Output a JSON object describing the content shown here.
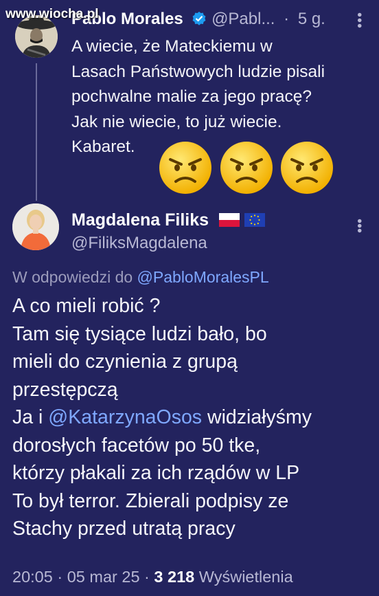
{
  "watermark": "www.wiocha.pl",
  "tweet1": {
    "display_name": "Pablo Morales",
    "handle": "@Pabl...",
    "time": "5 g.",
    "separator": "·",
    "body_lines": [
      "A wiecie, że Mateckiemu w",
      "Lasach Państwowych ludzie pisali",
      "pochwalne malie za jego pracę?",
      "Jak nie wiecie, to już wiecie.",
      "Kabaret."
    ],
    "emojis": [
      "angry-face-icon",
      "angry-face-icon",
      "angry-face-icon"
    ],
    "verified_icon": "verified-badge-icon",
    "more_icon": "more-options-icon"
  },
  "reply": {
    "display_name": "Magdalena Filiks",
    "flags": [
      "poland-flag-icon",
      "eu-flag-icon"
    ],
    "handle": "@FiliksMagdalena",
    "more_icon": "more-options-icon",
    "reply_prefix": "W odpowiedzi do",
    "reply_mention": "@PabloMoralesPL",
    "body": {
      "line1": "A co mieli robić ?",
      "line2": "Tam się tysiące ludzi bało, bo",
      "line3": "mieli do czynienia  z grupą",
      "line4": "przestępczą",
      "line5_prefix": "Ja i",
      "line5_mention": "@KatarzynaOsos",
      "line5_suffix": "widziałyśmy",
      "line6": "dorosłych facetów po 50 tke,",
      "line7": "którzy płakali za ich rządów w LP",
      "line8": "To był terror. Zbierali podpisy ze",
      "line9": "Stachy przed utratą pracy"
    },
    "meta": {
      "time": "20:05",
      "date": "05 mar 25",
      "separator": "·",
      "views_count": "3 218",
      "views_label": "Wyświetlenia"
    }
  },
  "colors": {
    "background": "#23235e",
    "link": "#7fa8ff",
    "muted": "#b8b8d4",
    "verified": "#1d9bf0"
  }
}
